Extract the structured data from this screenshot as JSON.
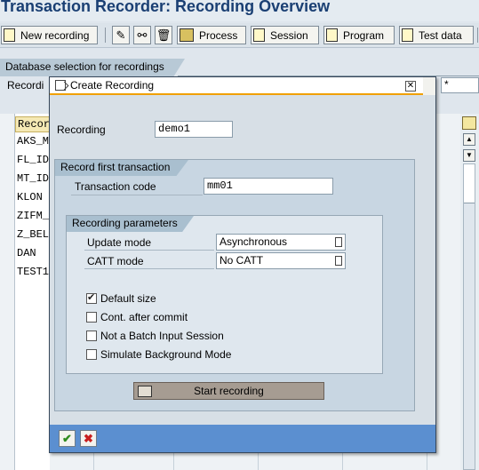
{
  "window_title": "Transaction Recorder: Recording Overview",
  "toolbar": {
    "new_recording": "New recording",
    "process": "Process",
    "session": "Session",
    "program": "Program",
    "test_data": "Test data"
  },
  "selection": {
    "section_title": "Database selection for recordings",
    "recording_label": "Recordi",
    "recording_value": "*"
  },
  "table": {
    "header": "Record",
    "rows": [
      "AKS_M",
      "FL_ID",
      "MT_ID",
      "KLON",
      "ZIFM_",
      "Z_BEL",
      "DAN",
      "TEST1"
    ]
  },
  "dialog": {
    "title": "Create Recording",
    "recording_label": "Recording",
    "recording_value": "demo1",
    "group_first": "Record first transaction",
    "tcode_label": "Transaction code",
    "tcode_value": "mm01",
    "group_params": "Recording parameters",
    "update_mode_label": "Update mode",
    "update_mode_value": "Asynchronous",
    "catt_mode_label": "CATT mode",
    "catt_mode_value": "No CATT",
    "checkboxes": [
      {
        "label": "Default size",
        "checked": true
      },
      {
        "label": "Cont. after commit",
        "checked": false
      },
      {
        "label": "Not a Batch Input Session",
        "checked": false
      },
      {
        "label": "Simulate Background Mode",
        "checked": false
      }
    ],
    "start_button": "Start recording",
    "ok_icon": "checkmark-icon",
    "cancel_icon": "cancel-x-icon",
    "close_glyph": "✕"
  },
  "colors": {
    "title_text": "#1a3f73",
    "dialog_footer": "#5b8fd0",
    "title_underline": "#f0a000",
    "ok_green": "#2e8b1e",
    "cancel_red": "#c81e1e"
  }
}
